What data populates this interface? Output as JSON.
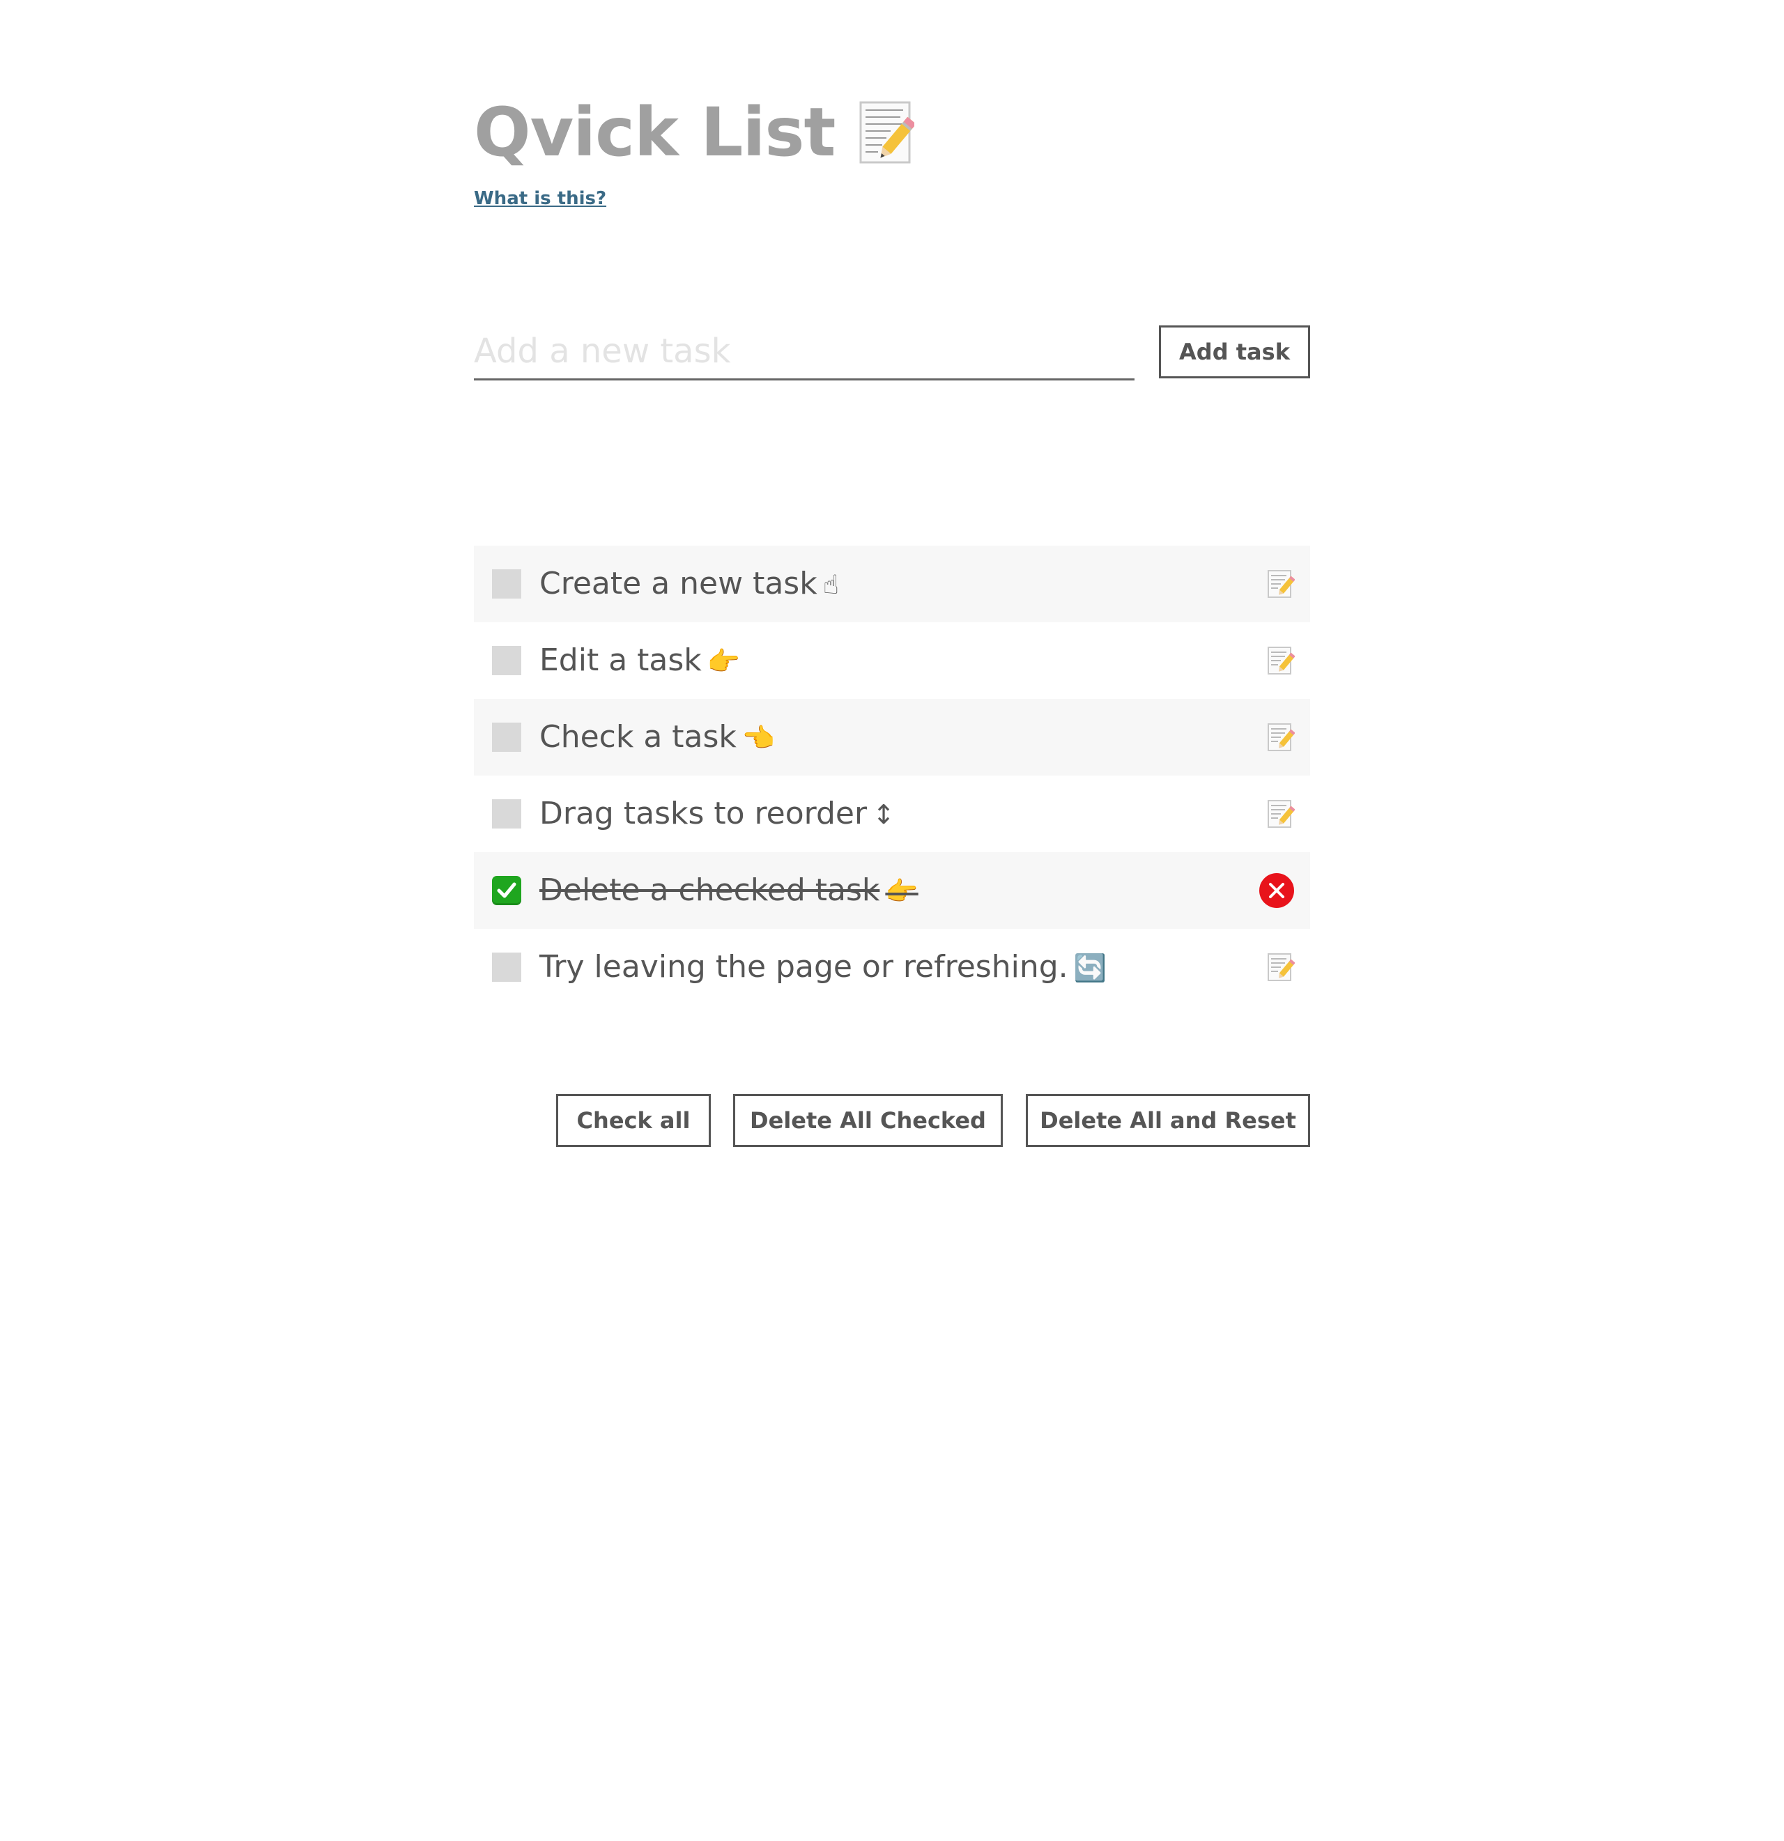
{
  "header": {
    "title": "Qvick List",
    "title_icon": "memo-icon",
    "what_link": "What is this?"
  },
  "add_task": {
    "placeholder": "Add a new task",
    "value": "",
    "button_label": "Add task"
  },
  "tasks": [
    {
      "text": "Create a new task",
      "emoji": "☝",
      "checked": false,
      "action_icon": "memo-icon"
    },
    {
      "text": "Edit a task",
      "emoji": "👉",
      "checked": false,
      "action_icon": "memo-icon"
    },
    {
      "text": "Check a task",
      "emoji": "👈",
      "checked": false,
      "action_icon": "memo-icon"
    },
    {
      "text": "Drag tasks to reorder",
      "emoji": "↕",
      "checked": false,
      "action_icon": "memo-icon"
    },
    {
      "text": "Delete a checked task",
      "emoji": "👉",
      "checked": true,
      "action_icon": "delete-x-icon"
    },
    {
      "text": "Try leaving the page or refreshing.",
      "emoji": "🔄",
      "checked": false,
      "action_icon": "memo-icon"
    }
  ],
  "actions": {
    "check_all": "Check all",
    "delete_all_checked": "Delete All Checked",
    "delete_all_reset": "Delete All and Reset"
  },
  "colors": {
    "title": "#a0a0a0",
    "link": "#3a6a86",
    "text": "#555555",
    "row_shade": "#f7f7f7",
    "checkbox": "#d9d9d9",
    "checked": "#1fa61f",
    "delete": "#e8131b"
  }
}
